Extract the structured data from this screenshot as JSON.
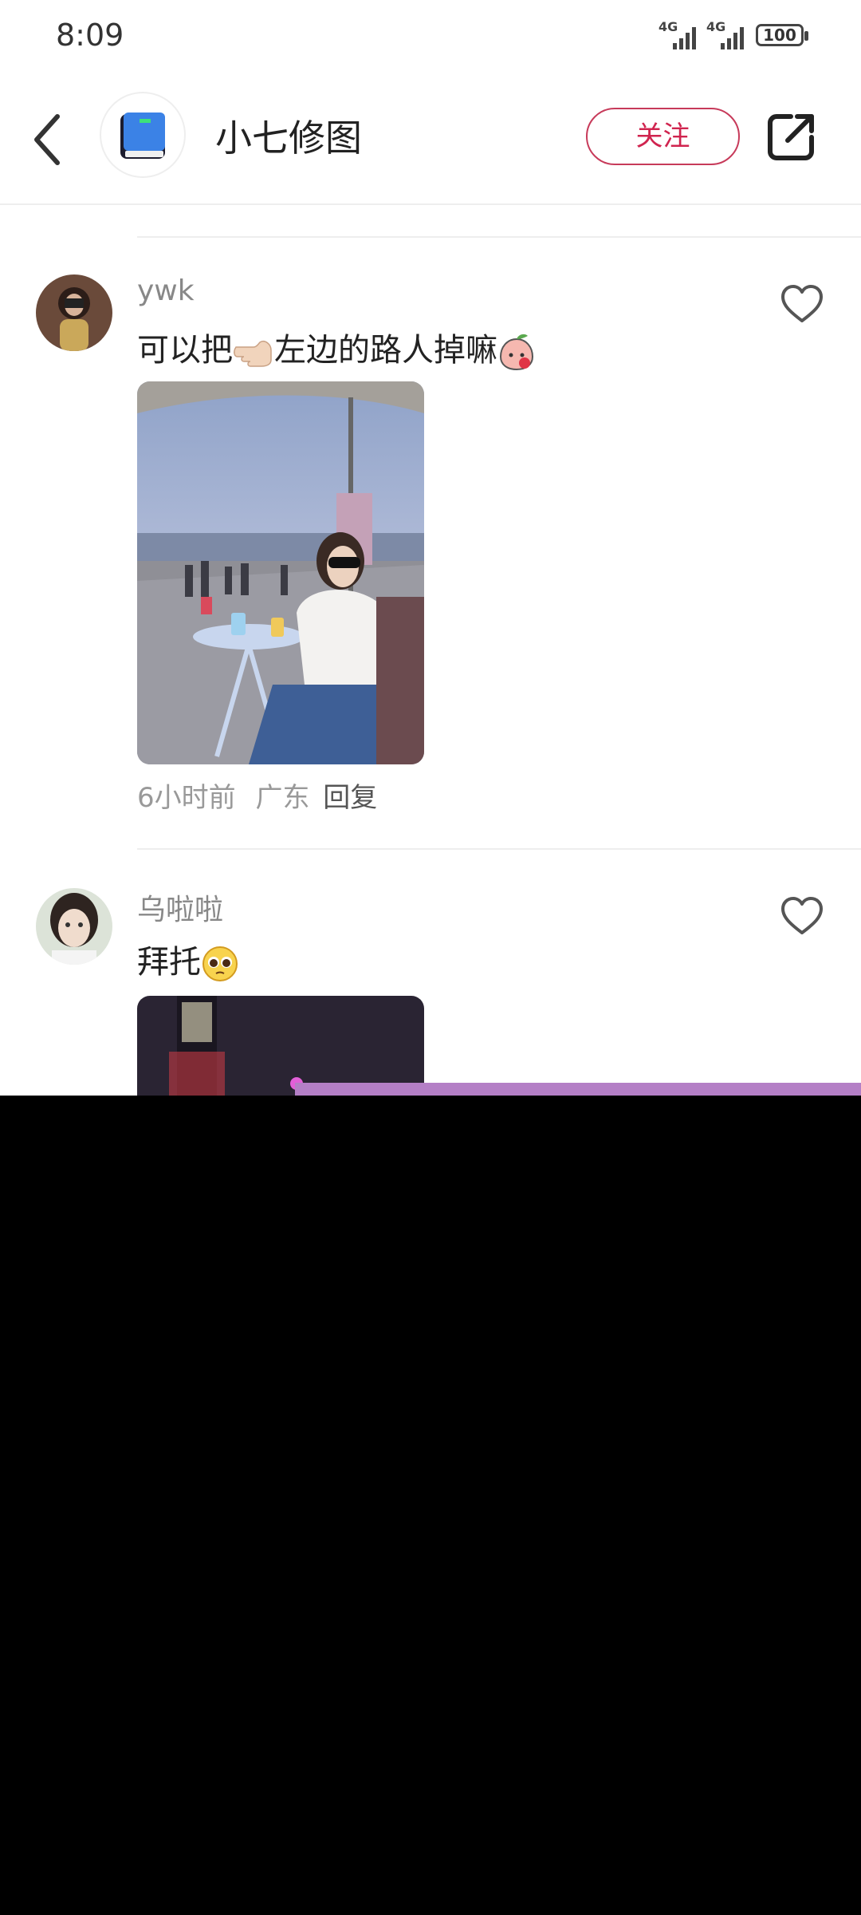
{
  "status_bar": {
    "time": "8:09",
    "network_1": "4G",
    "network_2": "4G",
    "battery": "100"
  },
  "header": {
    "title": "小七修图",
    "follow_label": "关注"
  },
  "comments": [
    {
      "username": "ywk",
      "text_before": "可以把",
      "text_after": "左边的路人掉嘛",
      "time": "6小时前",
      "location": "广东",
      "reply": "回复"
    },
    {
      "username": "乌啦啦",
      "text": "拜托"
    }
  ],
  "icons": {
    "back": "chevron-left-icon",
    "share": "share-external-icon",
    "like": "heart-outline-icon",
    "logo": "blue-book-icon"
  },
  "colors": {
    "accent": "#d0244f",
    "banner": "#b47fc6"
  }
}
